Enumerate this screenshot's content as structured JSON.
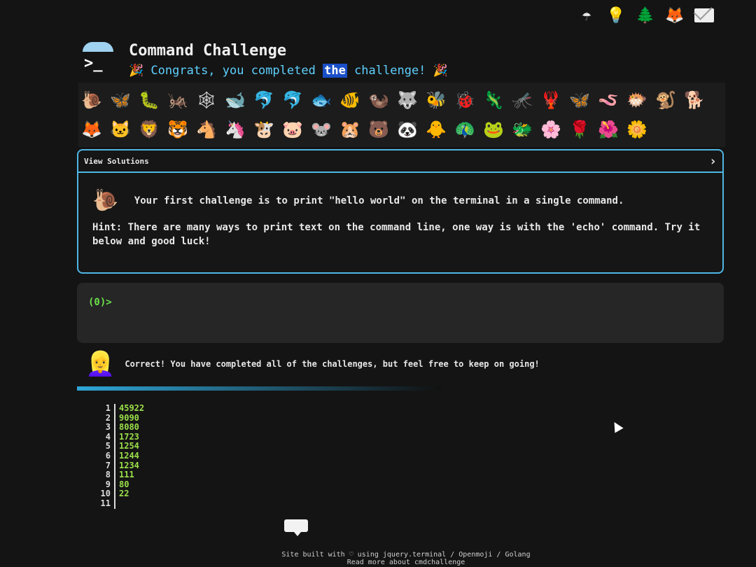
{
  "topbar": {
    "icons": [
      "umbrella-terminal-icon",
      "lightbulb-icon",
      "tree-icon",
      "gitlab-icon",
      "mail-icon"
    ]
  },
  "header": {
    "title": "Command Challenge",
    "congrats_pre": "Congrats, you ",
    "congrats_word1": "completed",
    "congrats_hl": "the",
    "congrats_post": "challenge!"
  },
  "emoji_rows": [
    [
      "🐌",
      "🦋",
      "🐛",
      "🦗",
      "🕸",
      "🐋",
      "🐬",
      "🐬",
      "🐟",
      "🐠",
      "🦦",
      "🐺",
      "🐝",
      "🐞",
      "🦎",
      "🦟",
      "🦞",
      "🦋",
      "🪱",
      "🐡",
      "🐒",
      "🐕"
    ],
    [
      "🦊",
      "🐱",
      "🦁",
      "🐯",
      "🐴",
      "🦄",
      "🐮",
      "🐷",
      "🐭",
      "🐹",
      "🐻",
      "🐼",
      "🐥",
      "🦚",
      "🐸",
      "🐲",
      "🌸",
      "🌹",
      "🌺",
      "🌼"
    ]
  ],
  "panel": {
    "header": "View Solutions",
    "chevron": "›",
    "challenge_text": "Your first challenge is to print \"hello world\" on the terminal in a single command.",
    "hint_text": "Hint: There are many ways to print text on the command line, one way is with the 'echo' command. Try it below and good luck!"
  },
  "terminal": {
    "prompt": "(0)>"
  },
  "correct": {
    "text": "Correct! You have completed all of the challenges, but feel free to keep on going!"
  },
  "output_lines": [
    {
      "n": "1",
      "v": "45922"
    },
    {
      "n": "2",
      "v": "9090"
    },
    {
      "n": "3",
      "v": "8080"
    },
    {
      "n": "4",
      "v": "1723"
    },
    {
      "n": "5",
      "v": "1254"
    },
    {
      "n": "6",
      "v": "1244"
    },
    {
      "n": "7",
      "v": "1234"
    },
    {
      "n": "8",
      "v": "111"
    },
    {
      "n": "9",
      "v": "80"
    },
    {
      "n": "10",
      "v": "22"
    },
    {
      "n": "11",
      "v": ""
    }
  ],
  "footer": {
    "line1": "Site built with ♡ using jquery.terminal / Openmoji / Golang",
    "line2": "Read more about cmdchallenge"
  }
}
